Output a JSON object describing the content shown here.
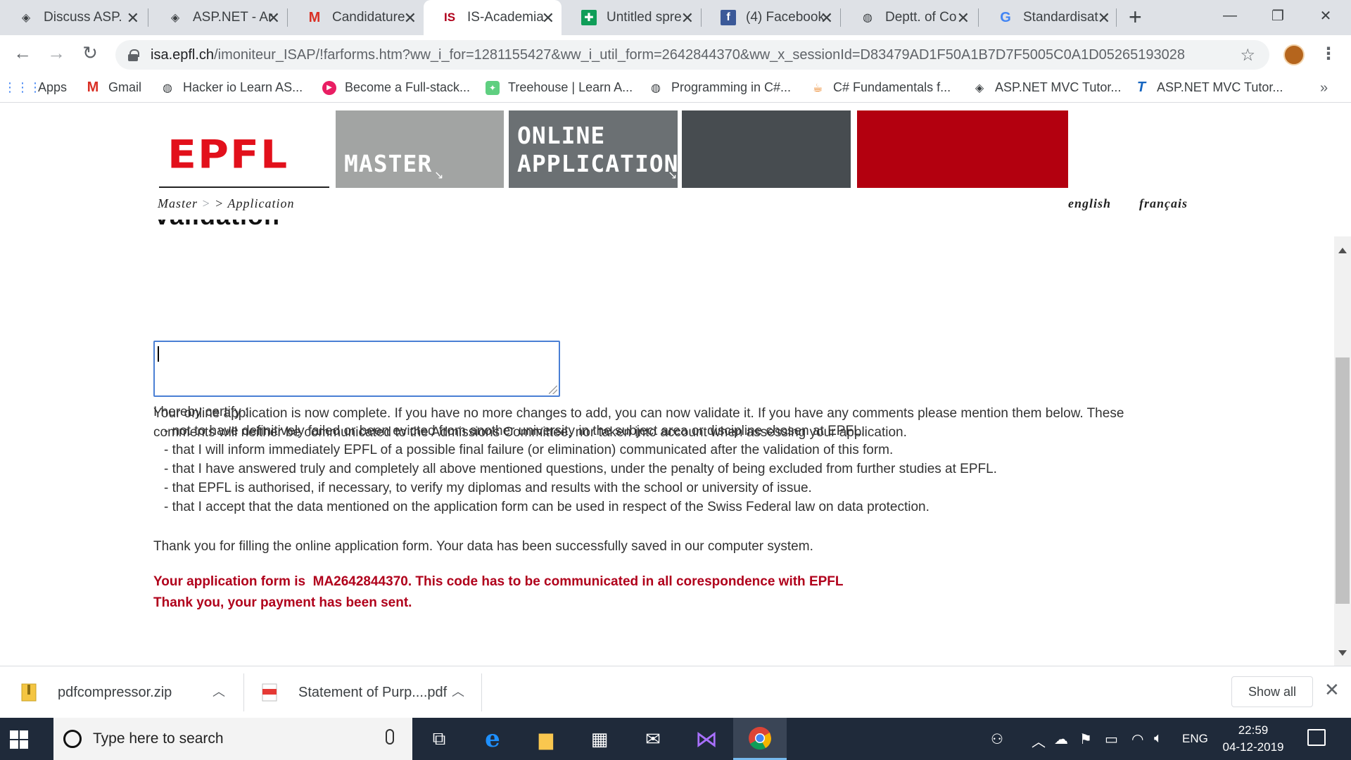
{
  "browser": {
    "tabs": [
      {
        "title": "Discuss ASP.",
        "icon": "aspnet-icon",
        "active": false
      },
      {
        "title": "ASP.NET - Ar",
        "icon": "aspnet-icon",
        "active": false
      },
      {
        "title": "Candidature",
        "icon": "gmail-icon",
        "active": false
      },
      {
        "title": "IS-Academia",
        "icon": "is-academia-icon",
        "active": true
      },
      {
        "title": "Untitled spre",
        "icon": "sheets-icon",
        "active": false
      },
      {
        "title": "(4) Facebook",
        "icon": "facebook-icon",
        "active": false
      },
      {
        "title": "Deptt. of Co",
        "icon": "globe-icon",
        "active": false
      },
      {
        "title": "Standardisat",
        "icon": "google-icon",
        "active": false
      }
    ],
    "address": {
      "host": "isa.epfl.ch",
      "path": "/imoniteur_ISAP/!farforms.htm?ww_i_for=1281155427&ww_i_util_form=2642844370&ww_x_sessionId=D83479AD1F50A1B7D7F5005C0A1D052651930284..."
    },
    "bookmarks": [
      {
        "label": "Apps",
        "icon": "apps-grid-icon"
      },
      {
        "label": "Gmail",
        "icon": "gmail-icon"
      },
      {
        "label": "Hacker io Learn AS...",
        "icon": "globe-icon"
      },
      {
        "label": "Become a Full-stack...",
        "icon": "play-icon"
      },
      {
        "label": "Treehouse | Learn A...",
        "icon": "treehouse-icon"
      },
      {
        "label": "Programming in C#...",
        "icon": "globe-icon"
      },
      {
        "label": "C# Fundamentals f...",
        "icon": "java-icon"
      },
      {
        "label": "ASP.NET MVC Tutor...",
        "icon": "aspnet-icon"
      },
      {
        "label": "ASP.NET MVC Tutor...",
        "icon": "tutorials-icon"
      }
    ]
  },
  "header": {
    "logo": "EPFL",
    "nav": {
      "master": "MASTER",
      "online_line1": "ONLINE",
      "online_line2": "APPLICATION"
    },
    "breadcrumb": {
      "first": "Master",
      "sep": ">",
      "second": "> Application"
    },
    "lang": {
      "english": "english",
      "french": "français"
    }
  },
  "main": {
    "section_title": "Validation",
    "intro": "Your online application is now complete. If you have no more changes to add, you can now validate it. If you have any comments please mention them below. These comments will neither be communicated to the Admissions Committee, nor taken into account when assessing your application.",
    "comment_value": "",
    "certify_label": "I hereby certify :",
    "certify_items": [
      "- not to have definitively failed or been evicted from another university in the subject area or discipline chosen at EPFL.",
      "- that I will inform immediately EPFL of a possible final failure (or elimination) communicated after the validation of this form.",
      "- that I have answered truly and completely all above mentioned questions, under the penalty of being excluded from further studies at EPFL.",
      "- that EPFL is authorised, if necessary, to verify my diplomas and results with the school or university of issue.",
      "- that I accept that the data mentioned on the application form can be used in respect of the Swiss Federal law on data protection."
    ],
    "thanks": "Thank you for filling the online application form. Your data has been successfully saved in our computer system.",
    "confirm_code": "Your application form is  MA2642844370. This code has to be communicated in all corespondence with EPFL",
    "payment": "Thank you, your payment has been sent."
  },
  "downloads": {
    "items": [
      {
        "name": "pdfcompressor.zip",
        "icon": "zip-file-icon"
      },
      {
        "name": "Statement of Purp....pdf",
        "icon": "pdf-file-icon"
      }
    ],
    "show_all": "Show all"
  },
  "taskbar": {
    "search_placeholder": "Type here to search",
    "lang": "ENG",
    "time": "22:59",
    "date": "04-12-2019"
  },
  "colors": {
    "epfl_red": "#e2101b",
    "block_grey1": "#a2a4a3",
    "block_grey2": "#6b7073",
    "block_grey3": "#474c50",
    "block_red": "#b3000f",
    "message_red": "#b0001b"
  }
}
